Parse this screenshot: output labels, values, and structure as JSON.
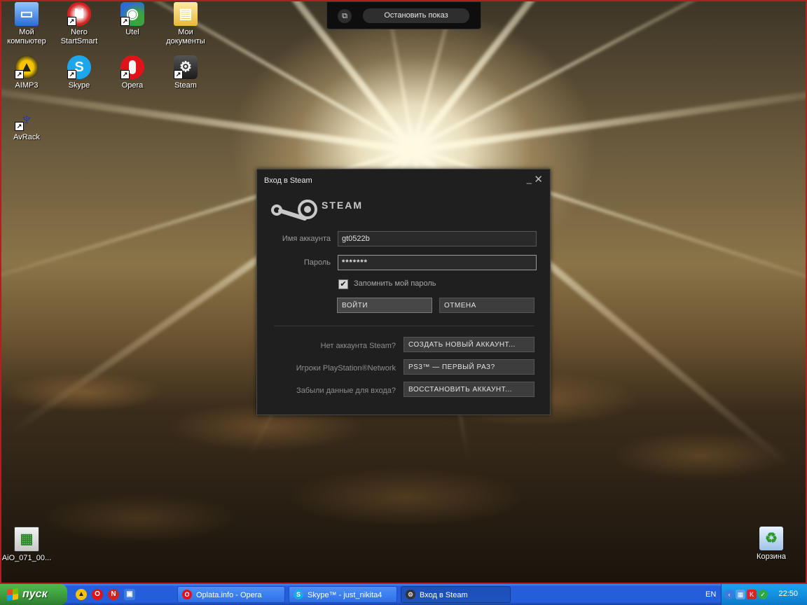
{
  "slideshow": {
    "stop_label": "Остановить показ"
  },
  "desktop_icons": [
    {
      "label": "Мой\nкомпьютер",
      "icon": "my-computer-icon"
    },
    {
      "label": "Nero\nStartSmart",
      "icon": "nero-icon"
    },
    {
      "label": "Utel",
      "icon": "utel-icon"
    },
    {
      "label": "Мои\nдокументы",
      "icon": "my-documents-icon"
    },
    {
      "label": "AIMP3",
      "icon": "aimp-icon"
    },
    {
      "label": "Skype",
      "icon": "skype-icon"
    },
    {
      "label": "Opera",
      "icon": "opera-icon"
    },
    {
      "label": "Steam",
      "icon": "steam-icon"
    },
    {
      "label": "AvRack",
      "icon": "avrack-icon"
    },
    {
      "label": "AiO_071_00...",
      "icon": "installer-icon"
    },
    {
      "label": "Корзина",
      "icon": "recycle-bin-icon"
    }
  ],
  "steam_login": {
    "window_title": "Вход в Steam",
    "brand": "STEAM",
    "account_label": "Имя аккаунта",
    "account_value": "gt0522b",
    "password_label": "Пароль",
    "password_value": "*******",
    "remember_label": "Запомнить мой пароль",
    "remember_checked": true,
    "login_button": "ВОЙТИ",
    "cancel_button": "ОТМЕНА",
    "no_account_question": "Нет аккаунта Steam?",
    "create_account_button": "СОЗДАТЬ НОВЫЙ АККАУНТ...",
    "psn_question": "Игроки PlayStation®Network",
    "psn_button": "PS3™ — ПЕРВЫЙ РАЗ?",
    "forgot_question": "Забыли данные для входа?",
    "recover_button": "ВОССТАНОВИТЬ АККАУНТ..."
  },
  "taskbar": {
    "start_label": "пуск",
    "tasks": [
      {
        "label": "Oplata.info - Opera",
        "icon": "opera-icon"
      },
      {
        "label": "Skype™ - just_nikita4",
        "icon": "skype-icon"
      },
      {
        "label": "Вход в Steam",
        "icon": "steam-icon",
        "active": true
      }
    ],
    "language": "EN",
    "clock": "22:50"
  },
  "colors": {
    "steam_bg": "#1f1f1f",
    "taskbar_blue": "#245edb",
    "start_green": "#3c9a3c",
    "tray_blue": "#1290df"
  }
}
